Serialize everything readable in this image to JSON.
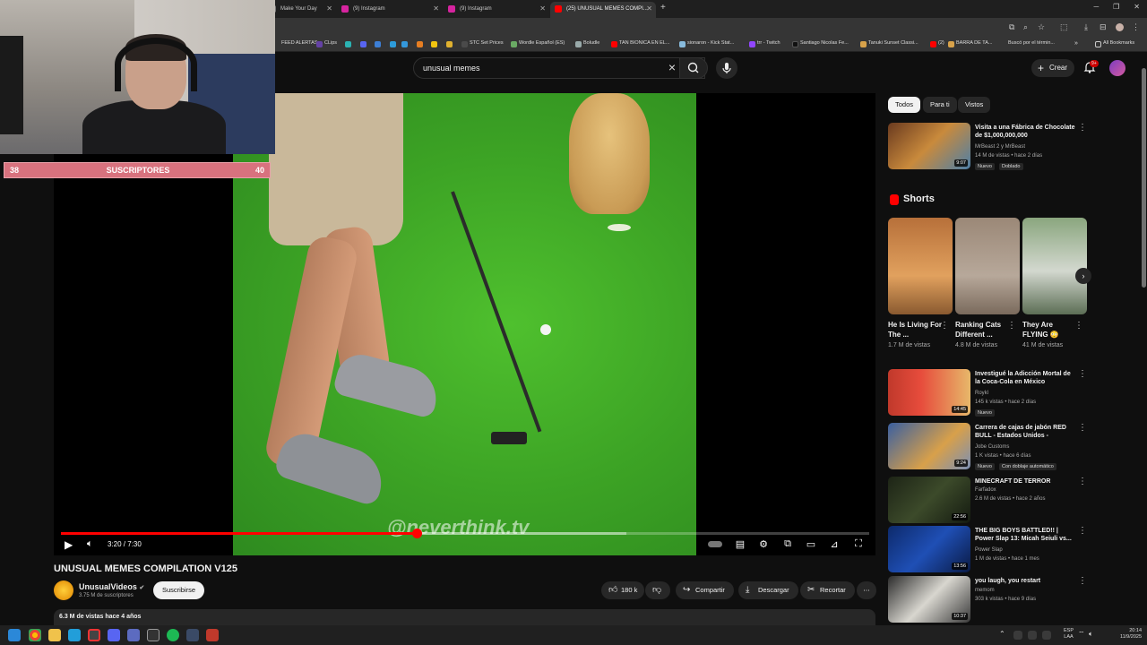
{
  "browser": {
    "tabs": [
      {
        "label": "Make Your Day"
      },
      {
        "label": "(9) Instagram"
      },
      {
        "label": "(9) Instagram"
      },
      {
        "label": "(25) UNUSUAL MEMES COMPI..."
      }
    ],
    "new_tab": "+",
    "bookmarks": [
      {
        "label": "FEED ALERTAS"
      },
      {
        "label": "CLips"
      },
      {
        "label": "STC Set Prices"
      },
      {
        "label": "Wordle Español (ES)"
      },
      {
        "label": "Boludle"
      },
      {
        "label": "TAN BIONICA EN EL..."
      },
      {
        "label": "sionaron - Kick Stat..."
      },
      {
        "label": "trr - Twitch"
      },
      {
        "label": "Santiago Nicolas Fe..."
      },
      {
        "label": "Tanuki Sunset Classi..."
      },
      {
        "label": "(2)"
      },
      {
        "label": "BARRA DE TA..."
      },
      {
        "label": "Buscó por el términ..."
      }
    ],
    "all_bookmarks": "All Bookmarks"
  },
  "webcam": {
    "sub_current": "38",
    "sub_label": "SUSCRIPTORES",
    "sub_goal": "40"
  },
  "header": {
    "search_value": "unusual memes",
    "create_label": "Crear",
    "notif_count": "9+"
  },
  "player": {
    "watermark": "@neverthink.tv",
    "time": "3:20 / 7:30",
    "progress": 0.44,
    "buffer": 0.7
  },
  "video": {
    "title": "UNUSUAL MEMES COMPILATION V125",
    "channel": "UnusualVideos",
    "subs": "3.75 M de suscriptores",
    "subscribe": "Suscribirse",
    "likes": "180 k",
    "share": "Compartir",
    "download": "Descargar",
    "clip": "Recortar",
    "stats": "6.3 M de vistas  hace 4 años"
  },
  "sidebar": {
    "chips": [
      {
        "label": "Todos"
      },
      {
        "label": "Para ti"
      },
      {
        "label": "Vistos"
      }
    ],
    "recs": [
      {
        "title": "Visita a una Fábrica de Chocolate de $1,000,000,000",
        "channel": "MrBeast 2 y MrBeast",
        "meta": "14 M de vistas • hace 2 días",
        "badge": "Nuevo",
        "badge2": "Doblado",
        "duration": "9:07"
      },
      {
        "title": "Investigué la Adicción Mortal de la Coca-Cola en México",
        "channel": "Roykl",
        "meta": "145 k vistas • hace 2 días",
        "badge": "Nuevo",
        "badge2": "",
        "duration": "14:45"
      },
      {
        "title": "Carrera de cajas de jabón RED BULL - Estados Unidos -",
        "channel": "Jobe Customs",
        "meta": "1 K vistas • hace 6 días",
        "badge": "Nuevo",
        "badge2": "Con doblaje automático",
        "duration": "9:24"
      },
      {
        "title": "MINECRAFT DE TERROR",
        "channel": "Farfadox",
        "meta": "2.6 M de vistas • hace 2 años",
        "badge": "",
        "badge2": "",
        "duration": "22:56"
      },
      {
        "title": "THE BIG BOYS BATTLED!! | Power Slap 13: Micah Seiuli vs...",
        "channel": "Power Slap",
        "meta": "1 M de vistas • hace 1 mes",
        "badge": "",
        "badge2": "",
        "duration": "13:56"
      },
      {
        "title": "you laugh, you restart",
        "channel": "memom",
        "meta": "303 k vistas • hace 9 días",
        "badge": "",
        "badge2": "",
        "duration": "10:37"
      }
    ],
    "shorts_label": "Shorts",
    "shorts": [
      {
        "title": "He Is Living For The ...",
        "views": "1.7 M de vistas"
      },
      {
        "title": "Ranking Cats Different ...",
        "views": "4.8 M de vistas"
      },
      {
        "title": "They Are FLYING 😳",
        "views": "41 M de vistas"
      }
    ]
  },
  "taskbar": {
    "lang": "ESP\nLAA",
    "time": "20:14",
    "date": "11/9/2025"
  },
  "colors": {
    "accent": "#ff0000",
    "background": "#0f0f0f",
    "sub_bar": "#d8727e"
  }
}
